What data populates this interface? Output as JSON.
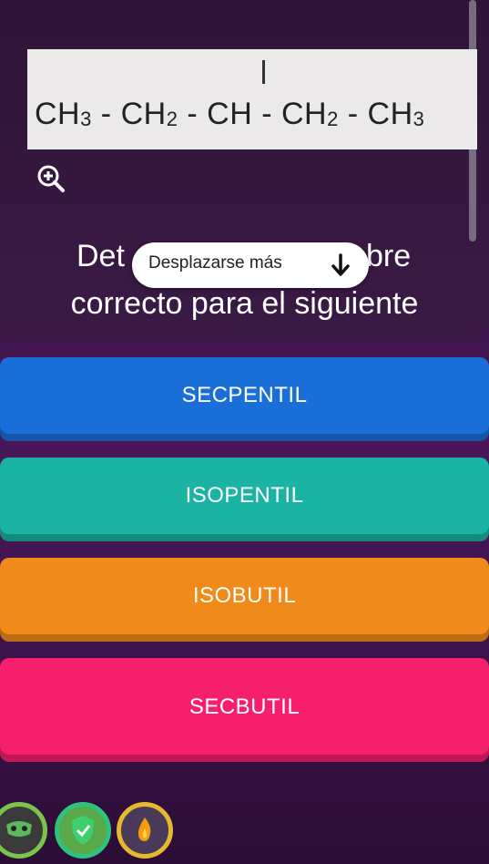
{
  "question": {
    "formula": {
      "parts": [
        "CH",
        "3",
        " - CH",
        "2",
        " - CH - CH",
        "2",
        " - CH",
        "3"
      ]
    },
    "text_line1_left": "Det",
    "text_line1_right": "bre",
    "text_line2": "correcto para el siguiente"
  },
  "scroll_hint": {
    "label": "Desplazarse más"
  },
  "options": [
    {
      "label": "SECPENTIL"
    },
    {
      "label": "ISOPENTIL"
    },
    {
      "label": "ISOBUTIL"
    },
    {
      "label": "SECBUTIL"
    }
  ],
  "colors": {
    "option_1": "#1a6ed8",
    "option_2": "#1bb3a3",
    "option_3": "#f08a1a",
    "option_4": "#f51f6c"
  },
  "icons": {
    "zoom": "zoom-in-icon",
    "scroll": "arrow-down-icon",
    "powerups": [
      "mask-icon",
      "shield-check-icon",
      "fire-icon"
    ]
  }
}
